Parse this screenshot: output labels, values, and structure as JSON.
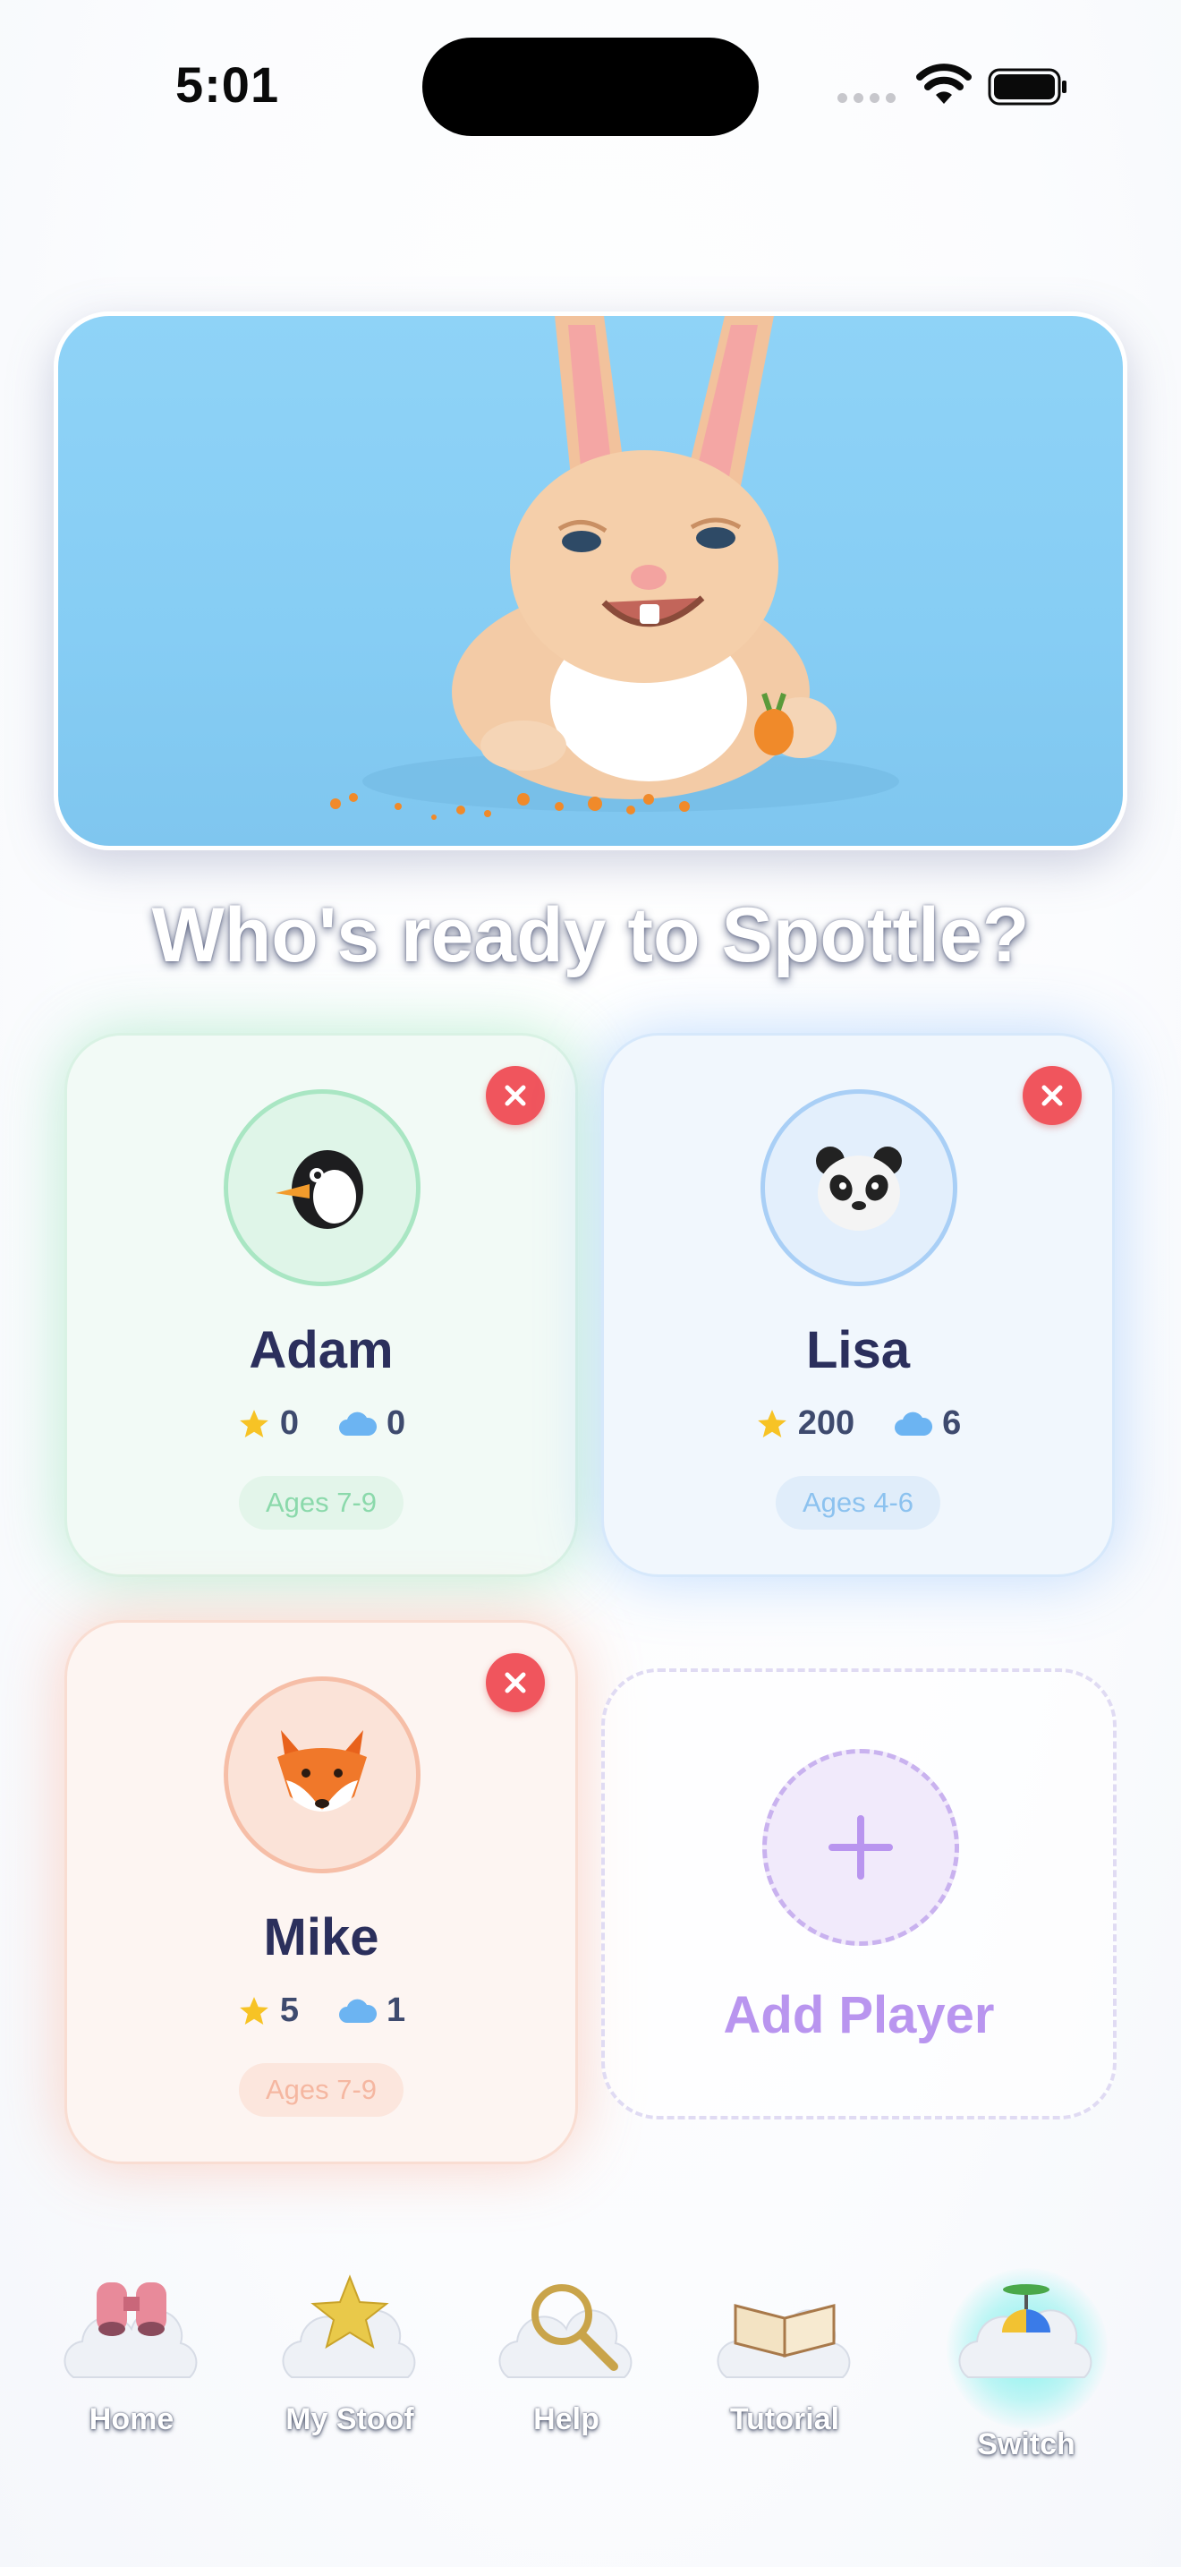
{
  "status_bar": {
    "time": "5:01"
  },
  "headline": "Who's ready to Spottle?",
  "players": [
    {
      "name": "Adam",
      "stars": "0",
      "clouds": "0",
      "age": "Ages 7-9",
      "avatar": "penguin-icon",
      "theme_color": "#a9e6c3"
    },
    {
      "name": "Lisa",
      "stars": "200",
      "clouds": "6",
      "age": "Ages 4-6",
      "avatar": "panda-icon",
      "theme_color": "#a9cff6"
    },
    {
      "name": "Mike",
      "stars": "5",
      "clouds": "1",
      "age": "Ages 7-9",
      "avatar": "fox-icon",
      "theme_color": "#f6bea7"
    }
  ],
  "add_player": {
    "label": "Add Player"
  },
  "nav": [
    {
      "label": "Home",
      "icon": "binoculars-cloud-icon"
    },
    {
      "label": "My Stoof",
      "icon": "star-cloud-icon"
    },
    {
      "label": "Help",
      "icon": "magnifier-cloud-icon"
    },
    {
      "label": "Tutorial",
      "icon": "book-cloud-icon"
    },
    {
      "label": "Switch",
      "icon": "propeller-hat-cloud-icon",
      "active": true
    }
  ],
  "colors": {
    "star": "#f7c325",
    "cloud_stat": "#6cb4f2",
    "delete": "#f0555d",
    "accent_purple": "#b995ef"
  }
}
